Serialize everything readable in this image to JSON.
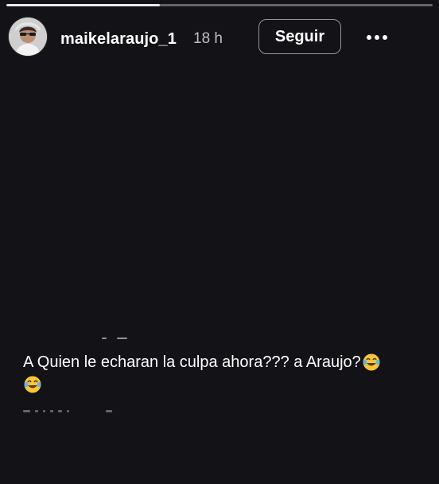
{
  "story": {
    "progress": 0.36,
    "progress_color": "#e8e8e8",
    "background_color": "#121217"
  },
  "header": {
    "avatar_icon": "user-avatar",
    "username": "maikelaraujo_1",
    "time_ago": "18 h",
    "follow_label": "Seguir",
    "more_icon": "more-horizontal-icon"
  },
  "caption": {
    "text": "A Quien le echaran la culpa ahora??? a Araujo?",
    "emoji": [
      "face-with-tears-of-joy",
      "face-with-tears-of-joy"
    ]
  }
}
